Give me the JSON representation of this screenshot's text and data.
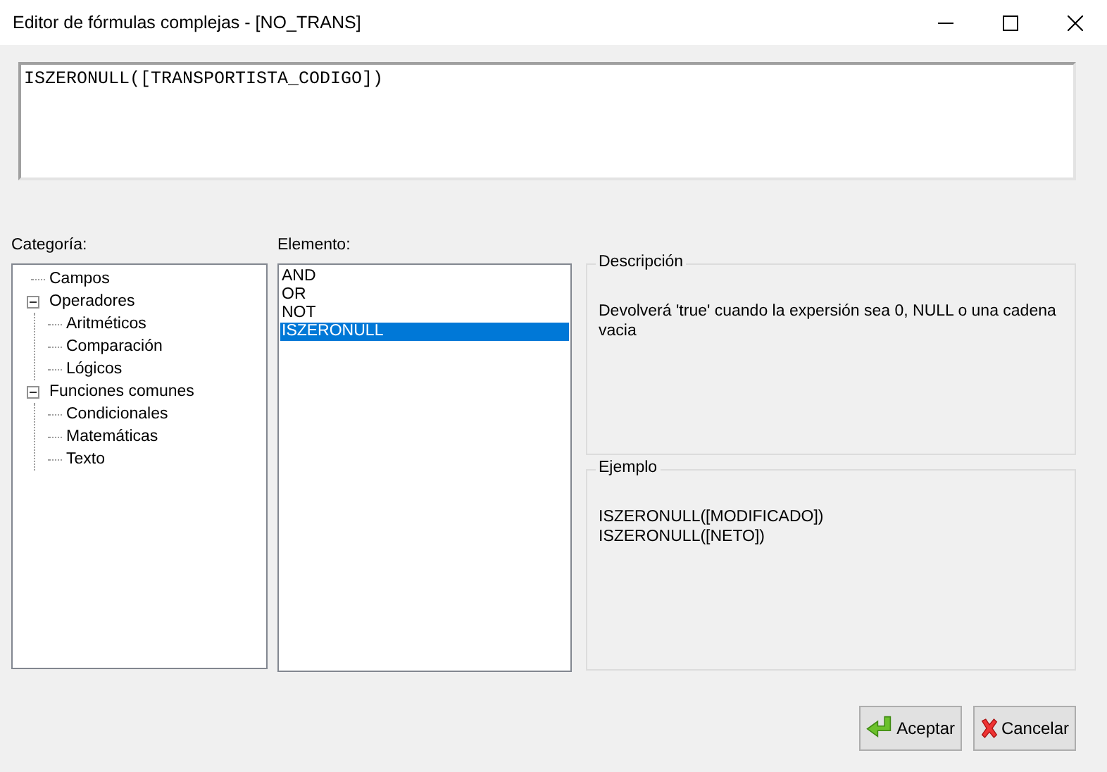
{
  "window": {
    "title": "Editor de fórmulas complejas - [NO_TRANS]"
  },
  "formula": {
    "value": "ISZERONULL([TRANSPORTISTA_CODIGO])"
  },
  "category": {
    "label": "Categoría:",
    "items": [
      {
        "label": "Campos"
      },
      {
        "label": "Operadores",
        "expanded": true,
        "children": [
          {
            "label": "Aritméticos"
          },
          {
            "label": "Comparación"
          },
          {
            "label": "Lógicos"
          }
        ]
      },
      {
        "label": "Funciones comunes",
        "expanded": true,
        "children": [
          {
            "label": "Condicionales"
          },
          {
            "label": "Matemáticas"
          },
          {
            "label": "Texto"
          }
        ]
      }
    ]
  },
  "element": {
    "label": "Elemento:",
    "items": [
      {
        "label": "AND",
        "selected": false
      },
      {
        "label": "OR",
        "selected": false
      },
      {
        "label": "NOT",
        "selected": false
      },
      {
        "label": "ISZERONULL",
        "selected": true
      }
    ]
  },
  "description": {
    "title": "Descripción",
    "text": "Devolverá 'true' cuando la expersión sea 0, NULL o una cadena vacia"
  },
  "example": {
    "title": "Ejemplo",
    "lines": [
      "ISZERONULL([MODIFICADO])",
      "ISZERONULL([NETO])"
    ]
  },
  "buttons": [
    {
      "kind": "accept",
      "label": "Aceptar"
    },
    {
      "kind": "cancel",
      "label": "Cancelar"
    }
  ]
}
